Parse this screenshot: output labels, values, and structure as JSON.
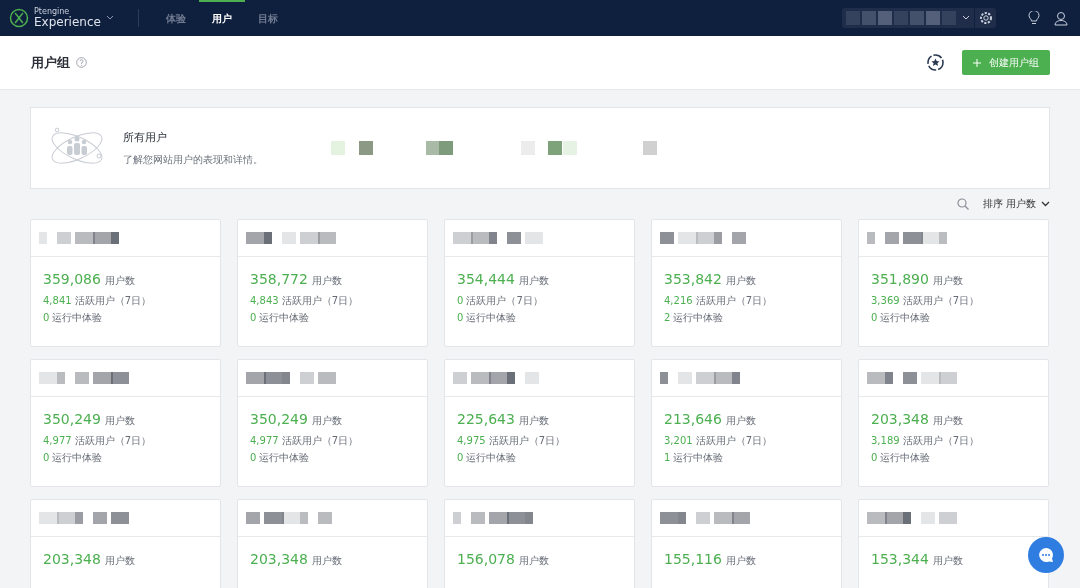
{
  "nav": {
    "brand_small": "Ptengine",
    "brand": "Experience",
    "tabs": [
      {
        "label": "体验",
        "selected": false
      },
      {
        "label": "用户",
        "selected": true
      },
      {
        "label": "目标",
        "selected": false
      }
    ]
  },
  "header": {
    "title": "用户组",
    "create_button": "创建用户组"
  },
  "banner": {
    "title": "所有用户",
    "description": "了解您网站用户的表现和详情。"
  },
  "sort": {
    "label": "排序 用户数"
  },
  "cards": [
    {
      "count": "359,086",
      "count_label": "用户数",
      "active": "4,841",
      "active_label": "活跃用户（7日）",
      "running": "0",
      "running_label": "运行中体验"
    },
    {
      "count": "358,772",
      "count_label": "用户数",
      "active": "4,843",
      "active_label": "活跃用户（7日）",
      "running": "0",
      "running_label": "运行中体验"
    },
    {
      "count": "354,444",
      "count_label": "用户数",
      "active": "0",
      "active_label": "活跃用户（7日）",
      "running": "0",
      "running_label": "运行中体验"
    },
    {
      "count": "353,842",
      "count_label": "用户数",
      "active": "4,216",
      "active_label": "活跃用户（7日）",
      "running": "2",
      "running_label": "运行中体验"
    },
    {
      "count": "351,890",
      "count_label": "用户数",
      "active": "3,369",
      "active_label": "活跃用户（7日）",
      "running": "0",
      "running_label": "运行中体验"
    },
    {
      "count": "350,249",
      "count_label": "用户数",
      "active": "4,977",
      "active_label": "活跃用户（7日）",
      "running": "0",
      "running_label": "运行中体验"
    },
    {
      "count": "350,249",
      "count_label": "用户数",
      "active": "4,977",
      "active_label": "活跃用户（7日）",
      "running": "0",
      "running_label": "运行中体验"
    },
    {
      "count": "225,643",
      "count_label": "用户数",
      "active": "4,975",
      "active_label": "活跃用户（7日）",
      "running": "0",
      "running_label": "运行中体验"
    },
    {
      "count": "213,646",
      "count_label": "用户数",
      "active": "3,201",
      "active_label": "活跃用户（7日）",
      "running": "1",
      "running_label": "运行中体验"
    },
    {
      "count": "203,348",
      "count_label": "用户数",
      "active": "3,189",
      "active_label": "活跃用户（7日）",
      "running": "0",
      "running_label": "运行中体验"
    },
    {
      "count": "203,348",
      "count_label": "用户数"
    },
    {
      "count": "203,348",
      "count_label": "用户数"
    },
    {
      "count": "156,078",
      "count_label": "用户数"
    },
    {
      "count": "155,116",
      "count_label": "用户数"
    },
    {
      "count": "153,344",
      "count_label": "用户数"
    }
  ]
}
